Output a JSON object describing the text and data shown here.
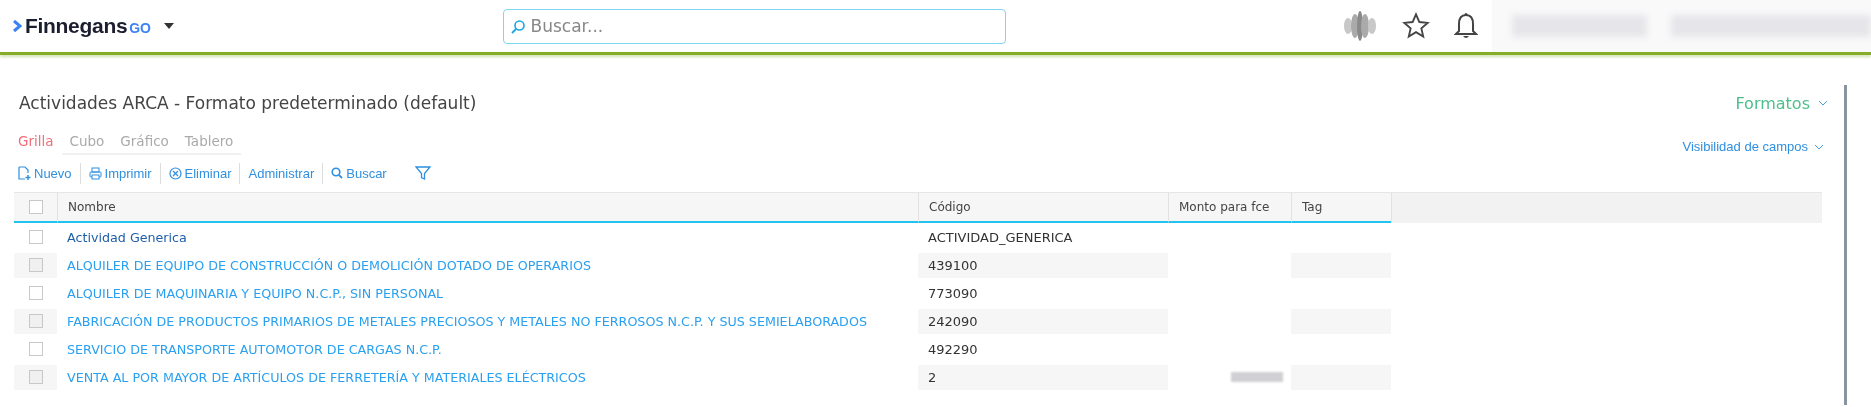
{
  "header": {
    "brand": "Finnegans",
    "brand_suffix": "GO",
    "search": {
      "placeholder": "Buscar..."
    }
  },
  "page": {
    "title": "Actividades ARCA - Formato predeterminado (default)",
    "formats": "Formatos",
    "field_visibility": "Visibilidad de campos"
  },
  "tabs": [
    {
      "label": "Grilla",
      "selected": true
    },
    {
      "label": "Cubo",
      "selected": false
    },
    {
      "label": "Gráfico",
      "selected": false
    },
    {
      "label": "Tablero",
      "selected": false
    }
  ],
  "toolbar": [
    {
      "kind": "new",
      "label": "Nuevo"
    },
    {
      "kind": "print",
      "label": "Imprimir"
    },
    {
      "kind": "delete",
      "label": "Eliminar"
    },
    {
      "kind": "plain",
      "label": "Administrar"
    },
    {
      "kind": "search",
      "label": "Buscar"
    },
    {
      "kind": "filter"
    }
  ],
  "table": {
    "all_selected": false,
    "columns": [
      "Nombre",
      "Código",
      "Monto para fce",
      "Tag"
    ],
    "rows": [
      {
        "name": "Actividad Generica",
        "code": "ACTIVIDAD_GENERICA",
        "checked": false
      },
      {
        "name": "ALQUILER DE EQUIPO DE CONSTRUCCIÓN O DEMOLICIÓN DOTADO DE OPERARIOS",
        "code": "439100",
        "checked": false
      },
      {
        "name": "ALQUILER DE MAQUINARIA Y EQUIPO N.C.P., SIN PERSONAL",
        "code": "773090",
        "checked": false
      },
      {
        "name": "FABRICACIÓN DE PRODUCTOS PRIMARIOS DE METALES PRECIOSOS Y METALES NO FERROSOS N.C.P. Y SUS SEMIELABORADOS",
        "code": "242090",
        "checked": false
      },
      {
        "name": "SERVICIO DE TRANSPORTE AUTOMOTOR DE CARGAS N.C.P.",
        "code": "492290",
        "checked": false
      },
      {
        "name": "VENTA AL POR MAYOR DE ARTÍCULOS DE FERRETERÍA Y MATERIALES ELÉCTRICOS",
        "code": "2",
        "checked": false,
        "blurred_amount": true
      }
    ]
  }
}
